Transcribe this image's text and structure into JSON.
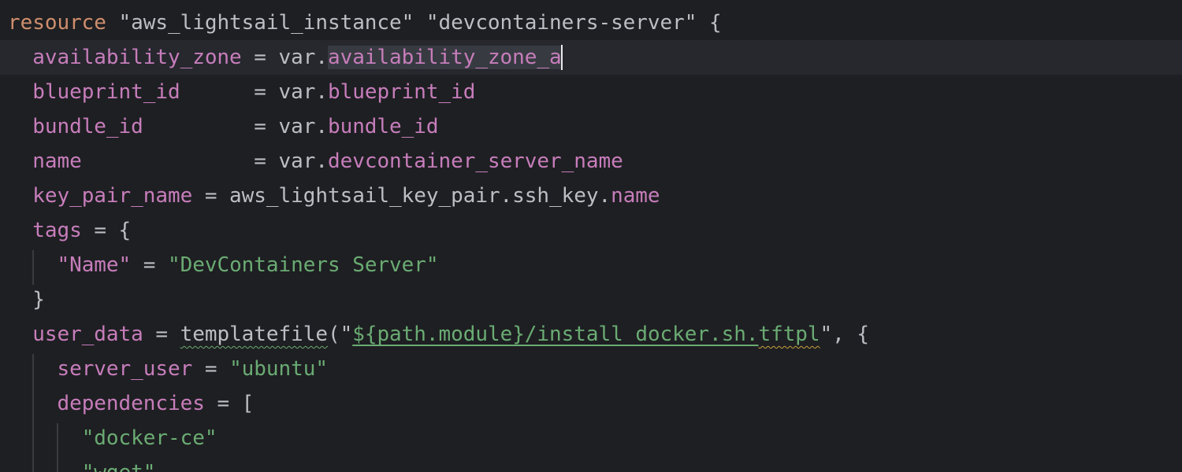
{
  "lines": [
    {
      "parts": [
        {
          "t": "resource",
          "c": "kw"
        },
        {
          "t": " \"aws_lightsail_instance\" \"devcontainers-server\" {",
          "c": "ident",
          "mix": [
            {
              "t": " ",
              "c": "ident"
            },
            {
              "t": "\"aws_lightsail_instance\"",
              "c": "ident"
            },
            {
              "t": " ",
              "c": "ident"
            },
            {
              "t": "\"devcontainers-server\"",
              "c": "ident"
            },
            {
              "t": " {",
              "c": "ident"
            }
          ]
        }
      ]
    },
    {
      "indent": "  ",
      "parts": [
        {
          "t": "availability_zone",
          "c": "attr"
        },
        {
          "t": " = var.",
          "c": "ident"
        },
        {
          "t": "availability_zone_a",
          "c": "attr sel"
        }
      ]
    },
    {
      "indent": "  ",
      "parts": [
        {
          "t": "blueprint_id",
          "c": "attr"
        },
        {
          "t": "      = var.",
          "c": "ident"
        },
        {
          "t": "blueprint_id",
          "c": "attr"
        }
      ]
    },
    {
      "indent": "  ",
      "parts": [
        {
          "t": "bundle_id",
          "c": "attr"
        },
        {
          "t": "         = var.",
          "c": "ident"
        },
        {
          "t": "bundle_id",
          "c": "attr"
        }
      ]
    },
    {
      "indent": "  ",
      "parts": [
        {
          "t": "name",
          "c": "attr"
        },
        {
          "t": "              = var.",
          "c": "ident"
        },
        {
          "t": "devcontainer_server_name",
          "c": "attr"
        }
      ]
    },
    {
      "indent": "  ",
      "parts": [
        {
          "t": "key_pair_name",
          "c": "attr"
        },
        {
          "t": " = aws_lightsail_key_pair.ssh_key.",
          "c": "ident"
        },
        {
          "t": "name",
          "c": "attr"
        }
      ]
    },
    {
      "indent": "  ",
      "parts": [
        {
          "t": "tags",
          "c": "attr"
        },
        {
          "t": " = {",
          "c": "ident"
        }
      ]
    },
    {
      "indent": "    ",
      "parts": [
        {
          "t": "\"Name\"",
          "c": "attr"
        },
        {
          "t": " = ",
          "c": "ident"
        },
        {
          "t": "\"DevContainers Server\"",
          "c": "str"
        }
      ]
    },
    {
      "indent": "  ",
      "parts": [
        {
          "t": "}",
          "c": "ident"
        }
      ]
    },
    {
      "indent": "  ",
      "parts": [
        {
          "t": "user_data",
          "c": "attr"
        },
        {
          "t": " = ",
          "c": "ident"
        },
        {
          "t": "templatefile",
          "c": "fn squig"
        },
        {
          "t": "(\"",
          "c": "ident"
        },
        {
          "t": "${path.module}/install_docker.sh.",
          "c": "str ul"
        },
        {
          "t": "tftpl",
          "c": "str squig-warn"
        },
        {
          "t": "\", {",
          "c": "ident"
        }
      ]
    },
    {
      "indent": "    ",
      "parts": [
        {
          "t": "server_user",
          "c": "attr"
        },
        {
          "t": " = ",
          "c": "ident"
        },
        {
          "t": "\"ubuntu\"",
          "c": "str"
        }
      ]
    },
    {
      "indent": "    ",
      "parts": [
        {
          "t": "dependencies",
          "c": "attr"
        },
        {
          "t": " = [",
          "c": "ident"
        }
      ]
    },
    {
      "indent": "      ",
      "parts": [
        {
          "t": "\"docker-ce\"",
          "c": "str"
        }
      ]
    },
    {
      "indent": "      ",
      "parts": [
        {
          "t": "\"wget\"",
          "c": "str"
        }
      ]
    }
  ]
}
